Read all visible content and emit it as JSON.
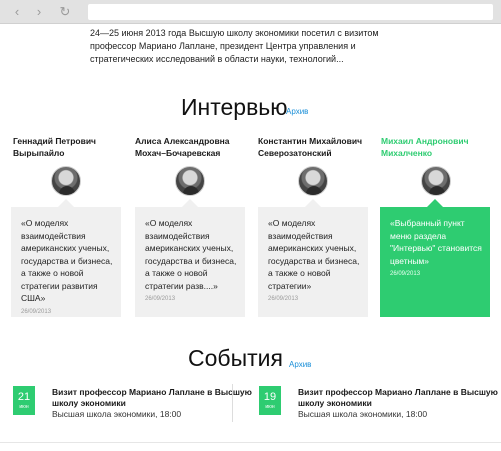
{
  "browser": {
    "back_icon": "chevron-left-icon",
    "forward_icon": "chevron-right-icon",
    "reload_icon": "reload-icon"
  },
  "intro": {
    "text": "24—25 июня 2013 года Высшую школу экономики посетил с визитом профессор Мариано Лаплане, президент Центра управления и стратегических исследований в области науки, технологий..."
  },
  "interviews": {
    "title": "Интервью",
    "archive_label": "Архив",
    "accent_color": "#2ecc71",
    "people": [
      {
        "name": "Геннадий Петрович Вырыпайло",
        "quote": "«О моделях взаимодействия американских ученых, государства и бизнеса, а также о новой стратегии развития США»",
        "date": "26/09/2013",
        "active": false
      },
      {
        "name": "Алиса Александровна Мохач–Бочаревская",
        "quote": "«О моделях взаимодействия американских ученых, государства и бизнеса, а также о новой стратегии разв....»",
        "date": "26/09/2013",
        "active": false
      },
      {
        "name": "Константин Михайлович Северозатонский",
        "quote": "«О моделях взаимодействия американских ученых, государства и бизнеса, а также о новой стратегии»",
        "date": "26/09/2013",
        "active": false
      },
      {
        "name": "Михаил Андронович Михалченко",
        "quote": "«Выбранный пункт меню раздела \"Интервью\" становится цветным»",
        "date": "26/09/2013",
        "active": true
      }
    ]
  },
  "events": {
    "title": "События",
    "archive_label": "Архив",
    "items": [
      {
        "day": "21",
        "month": "июн",
        "title": "Визит профессор Мариано Лаплане в Высшую школу экономики",
        "place": "Высшая школа экономики, 18:00"
      },
      {
        "day": "19",
        "month": "июн",
        "title": "Визит профессор Мариано Лаплане в Высшую школу экономики",
        "place": "Высшая школа экономики, 18:00"
      }
    ]
  }
}
